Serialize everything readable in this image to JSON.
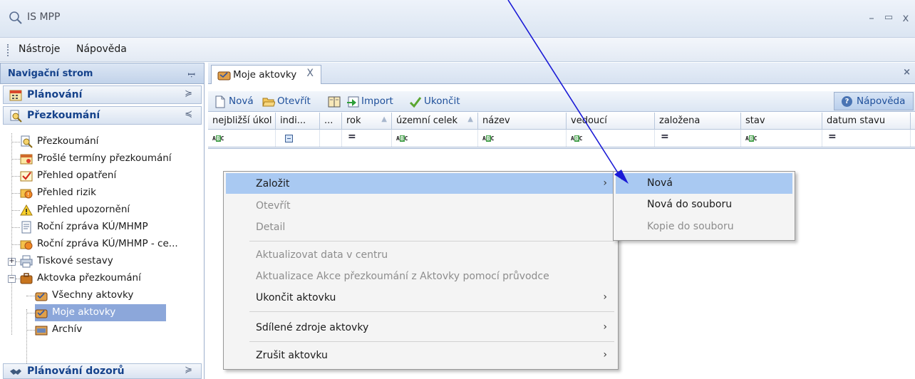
{
  "window": {
    "title": "IS MPP",
    "minimize_glyph": "–",
    "maximize_glyph": "▭",
    "close_glyph": "x"
  },
  "menubar": {
    "items": [
      "Nástroje",
      "Nápověda"
    ]
  },
  "nav": {
    "header": "Navigační strom",
    "groups": {
      "planovani": "Plánování",
      "prezkoumani": "Přezkoumání",
      "planovani_dozoru": "Plánování dozorů"
    },
    "tree": [
      {
        "label": "Přezkoumání",
        "icon": "magnifier-doc-icon"
      },
      {
        "label": "Prošlé termíny přezkoumání",
        "icon": "calendar-icon"
      },
      {
        "label": "Přehled opatření",
        "icon": "checklist-icon"
      },
      {
        "label": "Přehled rizik",
        "icon": "risk-icon"
      },
      {
        "label": "Přehled upozornění",
        "icon": "warning-icon"
      },
      {
        "label": "Roční zpráva KÚ/MHMP",
        "icon": "report-icon"
      },
      {
        "label": "Roční zpráva KÚ/MHMP - ce...",
        "icon": "report-star-icon"
      },
      {
        "label": "Tiskové sestavy",
        "icon": "printer-icon"
      },
      {
        "label": "Aktovka přezkoumání",
        "icon": "briefcase-icon"
      },
      {
        "label": "Všechny aktovky",
        "icon": "briefcase-check-icon"
      },
      {
        "label": "Moje aktovky",
        "icon": "briefcase-check-icon"
      },
      {
        "label": "Archív",
        "icon": "archive-icon"
      }
    ]
  },
  "doc": {
    "tab_label": "Moje aktovky",
    "tab_close": "X",
    "strip_close": "×",
    "toolbar": {
      "nova": "Nová",
      "otevrit": "Otevřít",
      "import": "Import",
      "ukoncit": "Ukončit",
      "napoveda": "Nápověda"
    },
    "columns": [
      "nejbližší úkol",
      "indi...",
      "...",
      "rok",
      "územní celek",
      "název",
      "vedoucí",
      "založena",
      "stav",
      "datum stavu"
    ]
  },
  "context_menu": {
    "items": {
      "zalozit": "Založit",
      "otevrit": "Otevřít",
      "detail": "Detail",
      "aktualizovat": "Aktualizovat data v centru",
      "aktualizace_akce": "Aktualizace Akce přezkoumání z Aktovky pomocí průvodce",
      "ukoncit": "Ukončit aktovku",
      "sdilene": "Sdílené zdroje aktovky",
      "zrusit": "Zrušit aktovku"
    },
    "submenu": {
      "nova": "Nová",
      "nova_do_souboru": "Nová do souboru",
      "kopie_do_souboru": "Kopie do souboru"
    }
  },
  "colors": {
    "annotation_arrow": "#1a1ad6",
    "highlight": "#a9c9f2",
    "selected_node": "#8ca7da"
  }
}
